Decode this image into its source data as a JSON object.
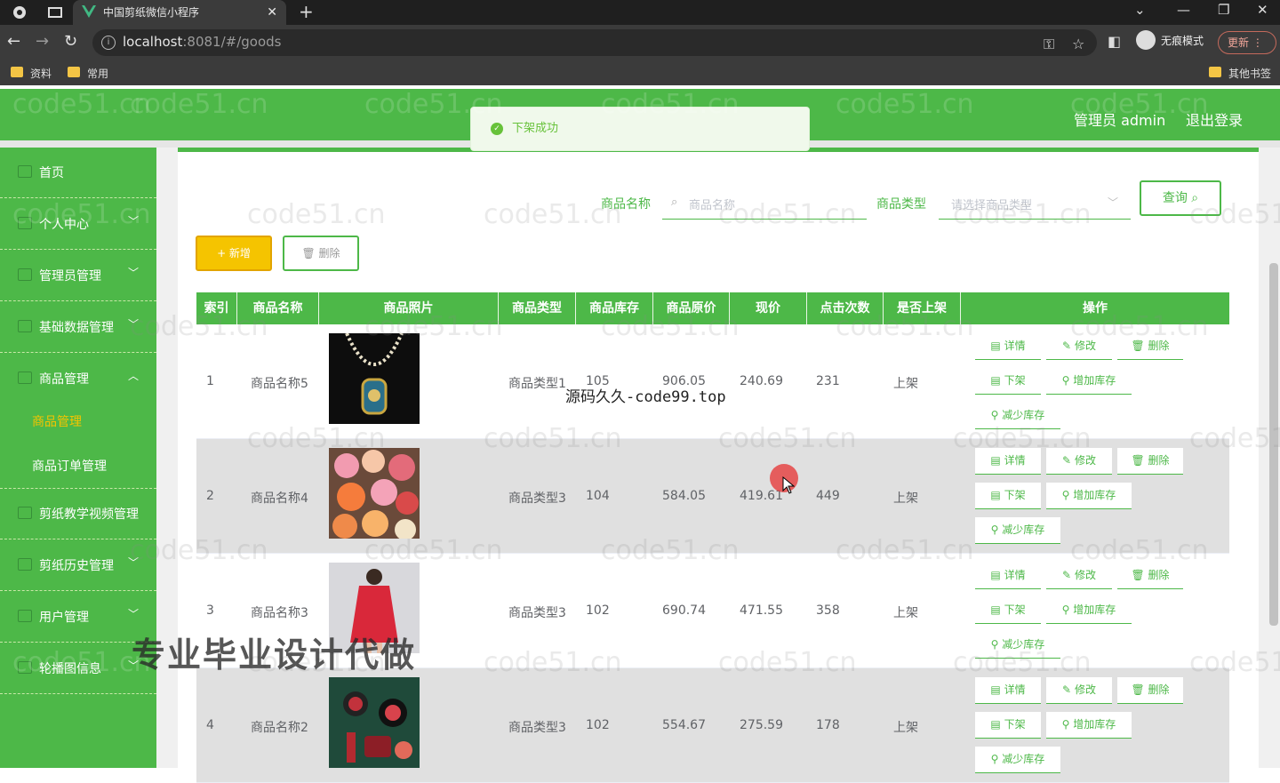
{
  "browser": {
    "tab_title": "中国剪纸微信小程序",
    "url_host": "localhost",
    "url_rest": ":8081/#/goods",
    "incognito_label": "无痕模式",
    "update_label": "更新",
    "bookmarks": [
      "资料",
      "常用"
    ],
    "other_bookmarks": "其他书签"
  },
  "header": {
    "admin_label": "管理员 admin",
    "logout_label": "退出登录"
  },
  "toast": {
    "message": "下架成功"
  },
  "sidebar": {
    "items": [
      {
        "label": "首页"
      },
      {
        "label": "个人中心"
      },
      {
        "label": "管理员管理"
      },
      {
        "label": "基础数据管理"
      },
      {
        "label": "商品管理"
      },
      {
        "label": "剪纸教学视频管理"
      },
      {
        "label": "剪纸历史管理"
      },
      {
        "label": "用户管理"
      },
      {
        "label": "轮播图信息"
      }
    ],
    "subitems": [
      {
        "label": "商品管理",
        "active": true
      },
      {
        "label": "商品订单管理",
        "active": false
      }
    ]
  },
  "search": {
    "name_label": "商品名称",
    "name_placeholder": "商品名称",
    "type_label": "商品类型",
    "type_placeholder": "请选择商品类型",
    "query_label": "查询"
  },
  "actions": {
    "add_label": "+ 新增",
    "delete_label": "删除"
  },
  "table": {
    "headers": [
      "索引",
      "商品名称",
      "商品照片",
      "商品类型",
      "商品库存",
      "商品原价",
      "现价",
      "点击次数",
      "是否上架",
      "操作"
    ],
    "ops": {
      "detail": "详情",
      "edit": "修改",
      "delete": "删除",
      "offshelf": "下架",
      "add_stock": "增加库存",
      "reduce_stock": "减少库存"
    },
    "rows": [
      {
        "index": "1",
        "name": "商品名称5",
        "type": "商品类型1",
        "stock": "105",
        "orig_price": "906.05",
        "price": "240.69",
        "clicks": "231",
        "on_shelf": "上架"
      },
      {
        "index": "2",
        "name": "商品名称4",
        "type": "商品类型3",
        "stock": "104",
        "orig_price": "584.05",
        "price": "419.61",
        "clicks": "449",
        "on_shelf": "上架"
      },
      {
        "index": "3",
        "name": "商品名称3",
        "type": "商品类型3",
        "stock": "102",
        "orig_price": "690.74",
        "price": "471.55",
        "clicks": "358",
        "on_shelf": "上架"
      },
      {
        "index": "4",
        "name": "商品名称2",
        "type": "商品类型3",
        "stock": "102",
        "orig_price": "554.67",
        "price": "275.59",
        "clicks": "178",
        "on_shelf": "上架"
      }
    ]
  },
  "watermark": "code51.cn",
  "overlays": {
    "source_text": "源码久久-code99.top",
    "promo_text": "专业毕业设计代做"
  }
}
